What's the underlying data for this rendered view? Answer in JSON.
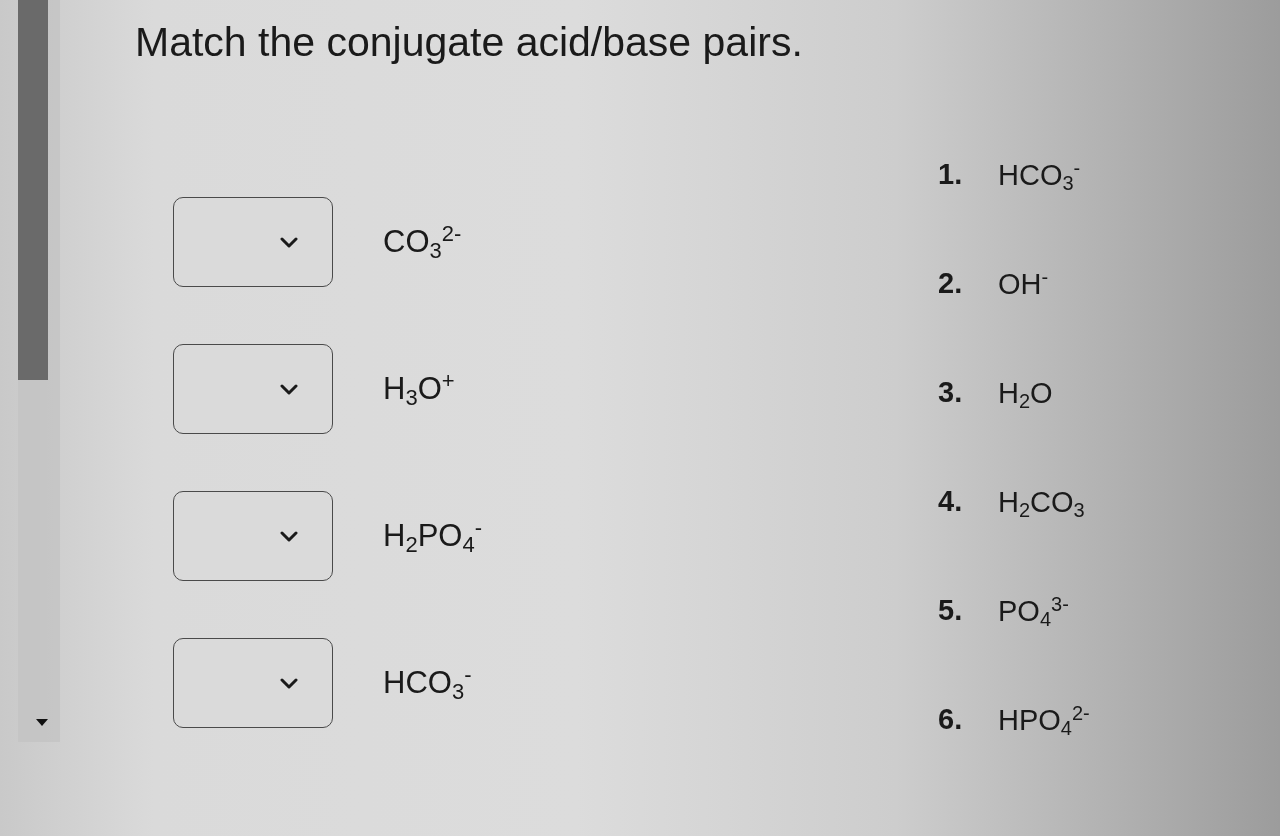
{
  "question": "Match the conjugate acid/base pairs.",
  "prompts": [
    {
      "formula": "CO$_{3}$$^{2-}$"
    },
    {
      "formula": "H$_{3}$O$^{+}$"
    },
    {
      "formula": "H$_{2}$PO$_{4}$$^{-}$"
    },
    {
      "formula": "HCO$_{3}$$^{-}$"
    }
  ],
  "answers": [
    {
      "number": "1.",
      "formula": "HCO$_{3}$$^{-}$"
    },
    {
      "number": "2.",
      "formula": "OH$^{-}$"
    },
    {
      "number": "3.",
      "formula": "H$_{2}$O"
    },
    {
      "number": "4.",
      "formula": "H$_{2}$CO$_{3}$"
    },
    {
      "number": "5.",
      "formula": "PO$_{4}$$^{3-}$"
    },
    {
      "number": "6.",
      "formula": "HPO$_{4}$$^{2-}$"
    }
  ]
}
